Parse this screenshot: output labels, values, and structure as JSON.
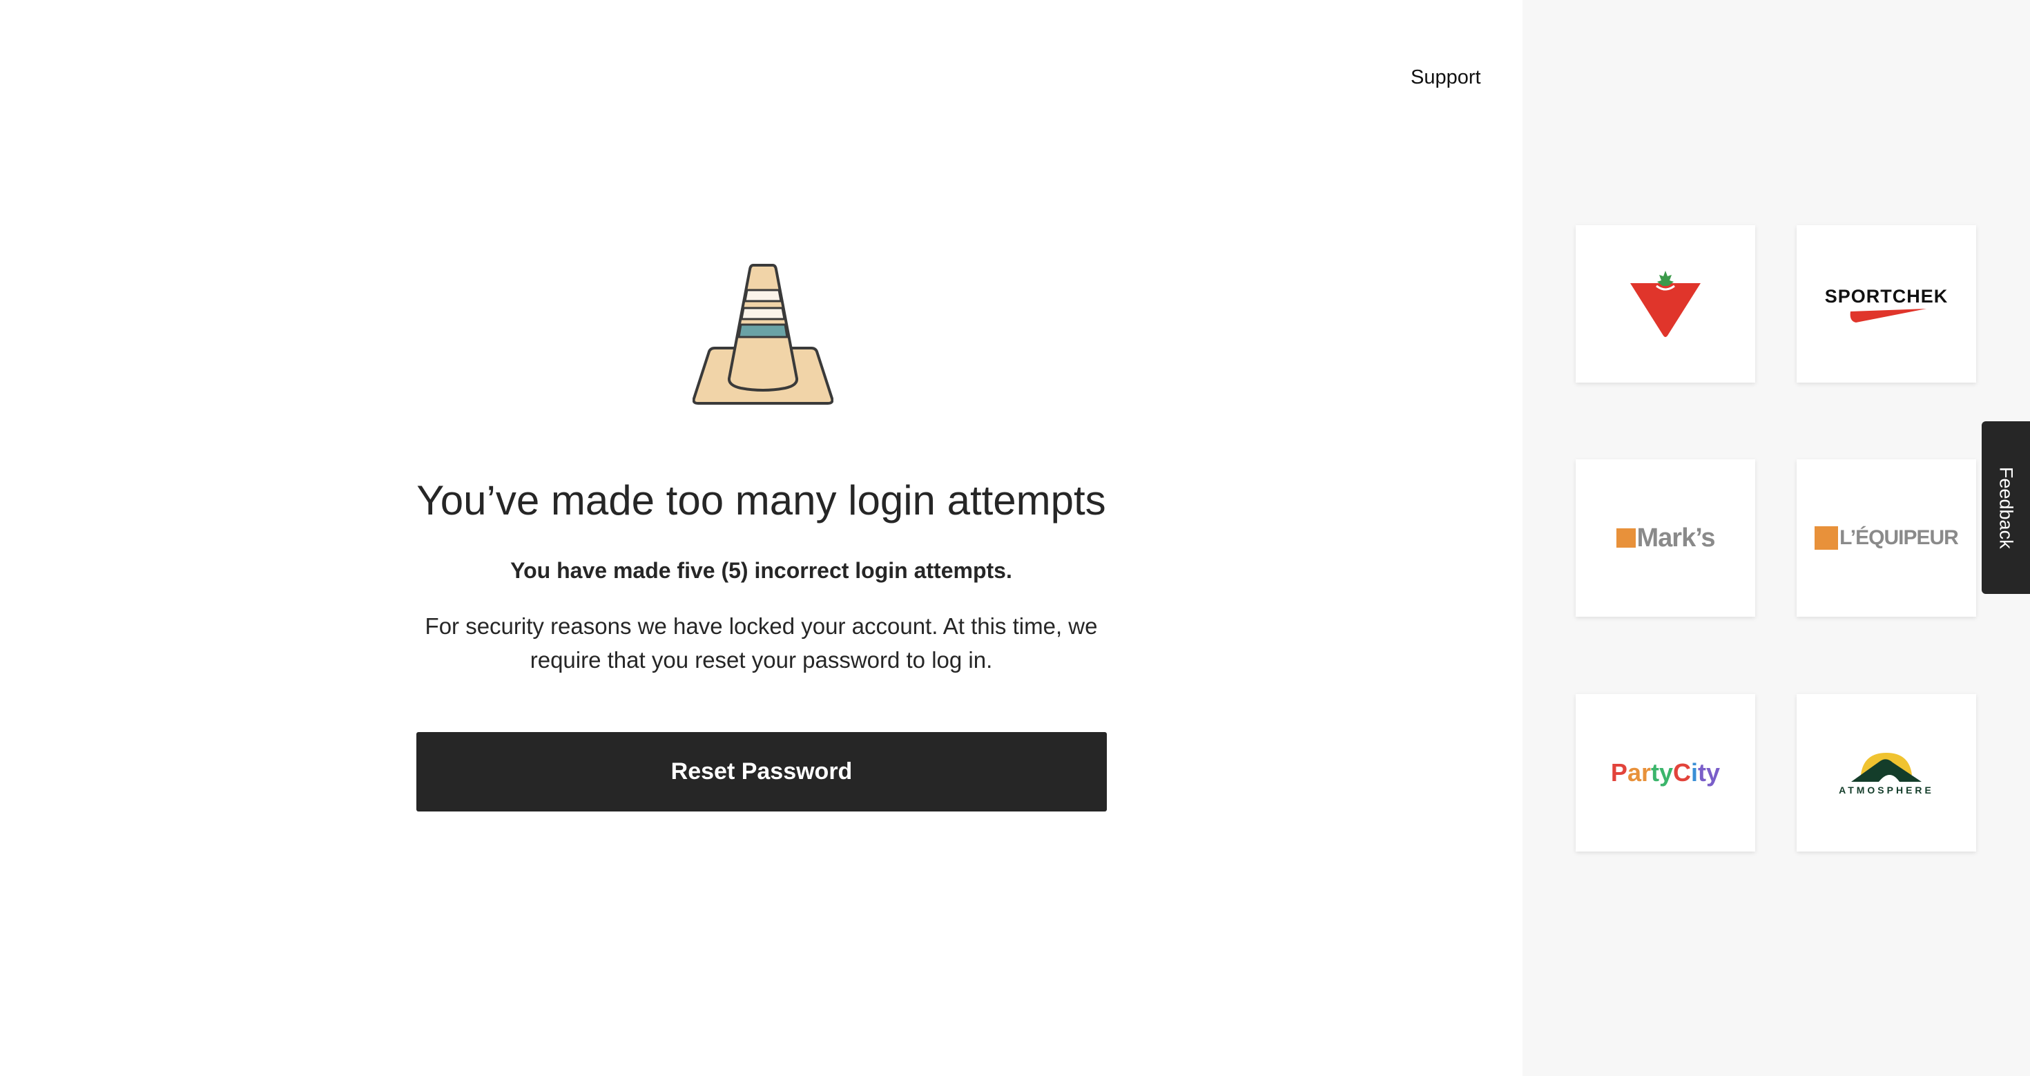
{
  "header": {
    "support_label": "Support"
  },
  "message": {
    "title": "You’ve made too many login attempts",
    "subtitle": "You have made five (5) incorrect login attempts.",
    "body_line1": "For security reasons we have locked your account. At this time, we",
    "body_line2": "require that you reset your password to log in."
  },
  "actions": {
    "reset_label": "Reset Password"
  },
  "brands": {
    "sportchek": "SPORTCHEK",
    "marks": "Mark’s",
    "lequipeur": "L’ÉQUIPEUR",
    "partycity_letters": [
      "P",
      "a",
      "r",
      "t",
      "y",
      "C",
      "i",
      "t",
      "y"
    ],
    "atmosphere": "ATMOSPHERE"
  },
  "feedback": {
    "label": "Feedback"
  },
  "colors": {
    "dark": "#262626",
    "panel_bg": "#f7f7f7",
    "canadian_tire_red": "#e0352b",
    "orange": "#e8913a",
    "party_colors": [
      "#e2433b",
      "#e8913a",
      "#e8913a",
      "#3bb56b",
      "#3bb56b",
      "#e2433b",
      "#3a8fd6",
      "#7a5ec9",
      "#7a5ec9"
    ]
  }
}
